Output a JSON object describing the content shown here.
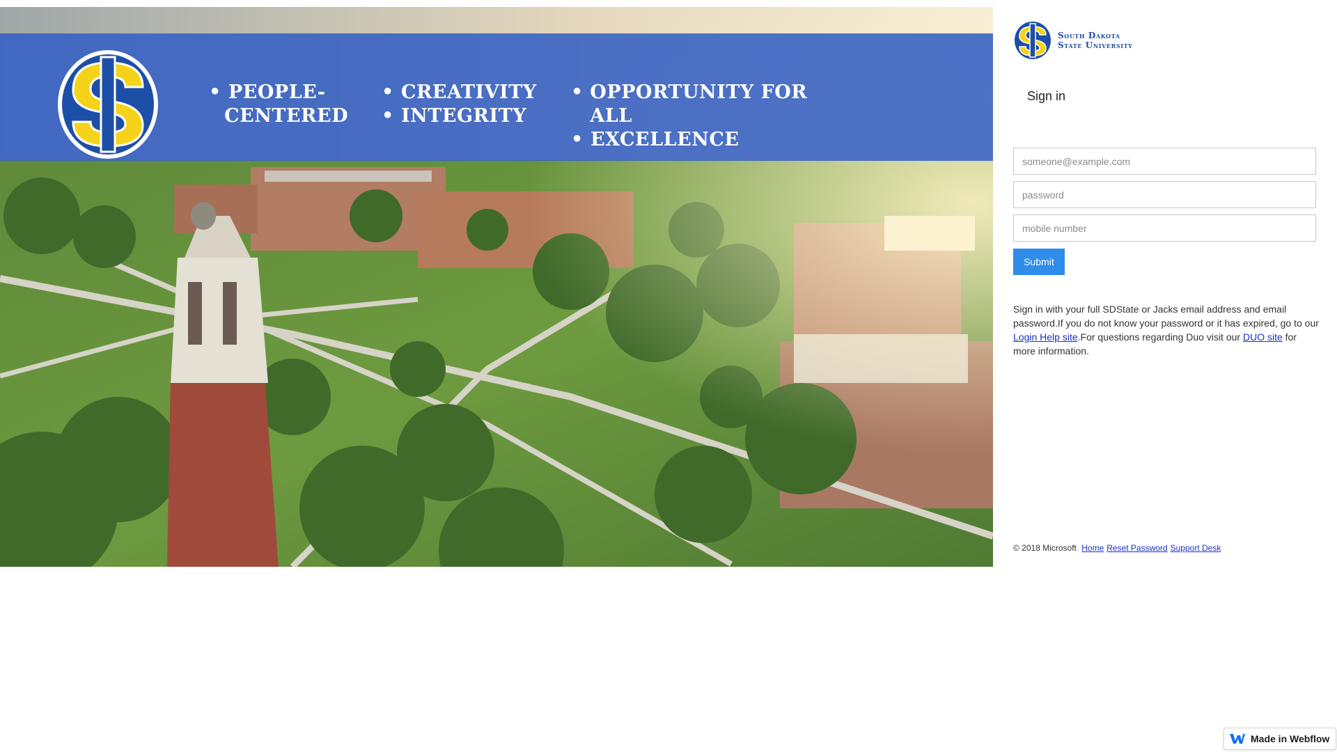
{
  "hero": {
    "values_col1": [
      "PEOPLE-",
      "CENTERED"
    ],
    "values_col2": [
      "CREATIVITY",
      "INTEGRITY"
    ],
    "values_col3": [
      "OPPORTUNITY FOR ALL",
      "EXCELLENCE"
    ],
    "bullet": "•"
  },
  "brand": {
    "line1": "South Dakota",
    "line2": "State University",
    "logo_icon": "sds-monogram-logo-icon"
  },
  "signin": {
    "title": "Sign in",
    "email_placeholder": "someone@example.com",
    "password_placeholder": "password",
    "mobile_placeholder": "mobile number",
    "submit_label": "Submit"
  },
  "help": {
    "text1": "Sign in with your full SDState or Jacks email address and email password.If you do not know your password or it has expired, go to our ",
    "login_help_link": "Login Help site",
    "text2": ".For questions regarding Duo visit our ",
    "duo_link": "DUO site",
    "text3": " for more information."
  },
  "footer": {
    "copyright": "© 2018 Microsoft",
    "home_link": "Home",
    "reset_link": "Reset Password",
    "support_link": "Support Desk"
  },
  "webflow": {
    "label": "Made in Webflow",
    "icon": "webflow-logo-icon"
  },
  "colors": {
    "banner": "#3460c4",
    "submit": "#2f8ce9",
    "link": "#1a2fc9",
    "brand_blue": "#1f4fa5",
    "brand_yellow": "#f5d31a"
  }
}
